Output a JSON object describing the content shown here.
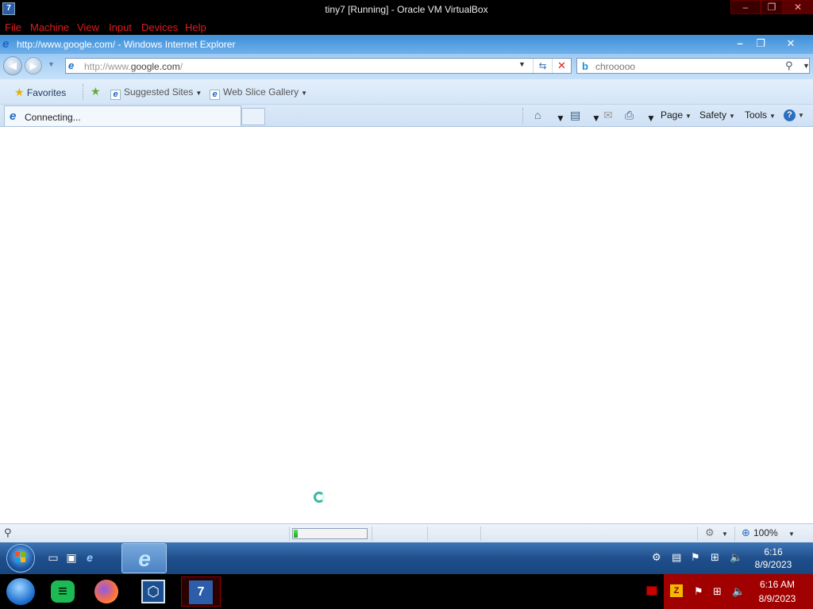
{
  "vbox": {
    "title": "tiny7 [Running] - Oracle VM VirtualBox",
    "menu": [
      "File",
      "Machine",
      "View",
      "Input",
      "Devices",
      "Help"
    ],
    "controls": {
      "minimize": "–",
      "maximize": "❐",
      "close": "✕"
    }
  },
  "ie": {
    "window_title": "http://www.google.com/ - Windows Internet Explorer",
    "address": {
      "prefix": "http://www.",
      "domain": "google.com",
      "suffix": "/"
    },
    "search_text": "chrooooo",
    "favorites_label": "Favorites",
    "suggested_sites": "Suggested Sites",
    "web_slice_gallery": "Web Slice Gallery",
    "tab_label": "Connecting...",
    "commands": {
      "page": "Page",
      "safety": "Safety",
      "tools": "Tools"
    },
    "zoom": "100%",
    "progress_fraction": 0.05
  },
  "guest_taskbar": {
    "time": "6:16",
    "date": "8/9/2023"
  },
  "host_taskbar": {
    "time": "6:16 AM",
    "date": "8/9/2023"
  },
  "colors": {
    "vbox_menu": "#e21b1b",
    "host_tray": "#a00000",
    "ie_title": "#3f8fd8"
  }
}
